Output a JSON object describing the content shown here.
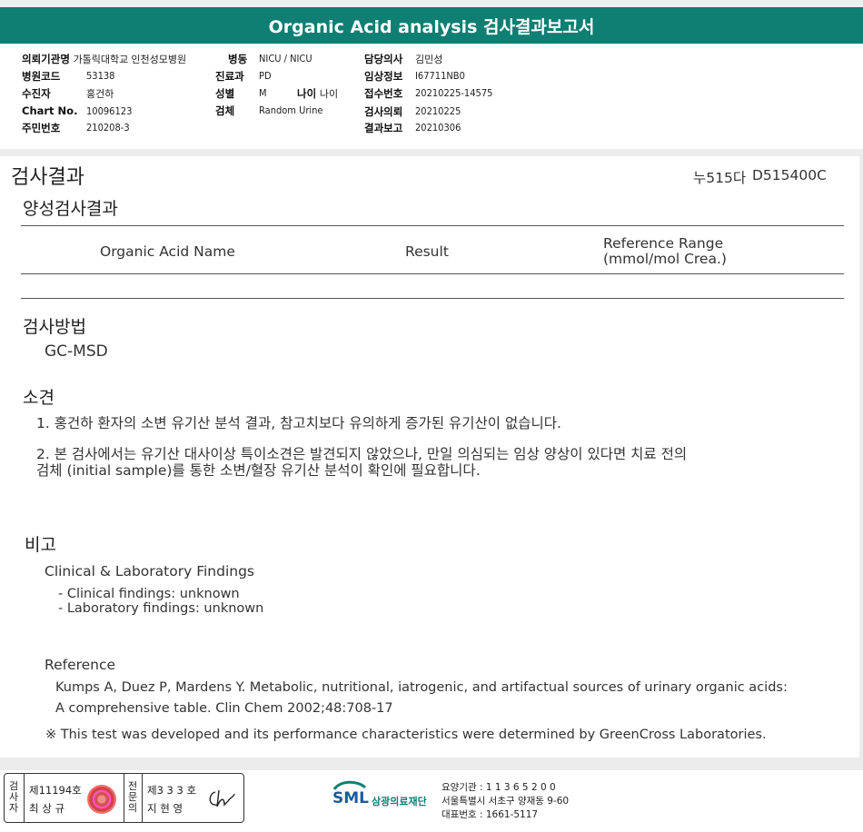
{
  "header": {
    "title": "Organic Acid analysis 검사결과보고서"
  },
  "info": {
    "col1": [
      {
        "label": "의뢰기관명",
        "value": "가톨릭대학교 인천성모병원"
      },
      {
        "label": "병원코드",
        "value": "53138"
      },
      {
        "label": "수진자",
        "value": "홍건하"
      },
      {
        "label": "Chart No.",
        "value": "10096123"
      },
      {
        "label": "주민번호",
        "value": "210208-3"
      }
    ],
    "col2": [
      {
        "label": "병동",
        "value": "NICU / NICU"
      },
      {
        "label": "진료과",
        "value": "PD"
      },
      {
        "label": "성별",
        "value": "M"
      },
      {
        "label": "검체",
        "value": "Random Urine"
      }
    ],
    "age": {
      "label": "나이",
      "value": "나이"
    },
    "col3": [
      {
        "label": "담당의사",
        "value": "김민성"
      },
      {
        "label": "임상정보",
        "value": "I67711NB0"
      },
      {
        "label": "접수번호",
        "value": "20210225-14575"
      },
      {
        "label": "검사의뢰",
        "value": "20210225"
      },
      {
        "label": "결과보고",
        "value": "20210306"
      }
    ]
  },
  "result": {
    "title": "검사결과",
    "code1": "누515다",
    "code2": "D515400C",
    "positive_title": "양성검사결과",
    "table_headers": {
      "name": "Organic Acid Name",
      "result": "Result",
      "range_line1": "Reference Range",
      "range_line2": "(mmol/mol Crea.)"
    }
  },
  "method": {
    "title": "검사방법",
    "value": "GC-MSD"
  },
  "opinion": {
    "title": "소견",
    "item1": "1. 홍건하 환자의 소변 유기산 분석 결과, 참고치보다 유의하게 증가된 유기산이 없습니다.",
    "item2_line1": "2. 본 검사에서는 유기산 대사이상 특이소견은 발견되지 않았으나, 만일 의심되는 임상 양상이 있다면 치료 전의",
    "item2_line2": "검체 (initial sample)를 통한 소변/혈장 유기산 분석이 확인에 필요합니다."
  },
  "remarks": {
    "title": "비고",
    "findings_title": "Clinical & Laboratory Findings",
    "finding1": "- Clinical findings: unknown",
    "finding2": "- Laboratory findings: unknown",
    "reference_title": "Reference",
    "reference_line1": "Kumps A, Duez P, Mardens Y. Metabolic, nutritional, iatrogenic, and artifactual sources of urinary organic acids:",
    "reference_line2": "A comprehensive table. Clin Chem 2002;48:708-17",
    "note": "※ This test was developed and its performance characteristics were determined by GreenCross Laboratories."
  },
  "footer": {
    "inspector_label": "검사자",
    "inspector_no": "제11194호",
    "inspector_name": "최 상 규",
    "specialist_label": "전문의",
    "specialist_no": "제3 3 3 호",
    "specialist_name": "지 현 영",
    "logo_text": "SML",
    "logo_name": "삼광의료재단",
    "addr1": "요양기관 : 1 1 3 6 5 2 0 0",
    "addr2": "서울특별시 서초구 양재동 9-60",
    "addr3": "대표번호 : 1661-5117"
  }
}
